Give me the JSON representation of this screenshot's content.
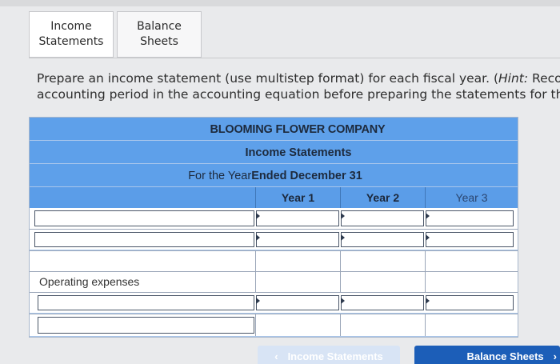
{
  "tabs": [
    {
      "label": "Income\nStatements",
      "active": true
    },
    {
      "label": "Balance\nSheets",
      "active": false
    }
  ],
  "instructions": {
    "line1_a": "Prepare an income statement (use multistep format) for each fiscal year. (",
    "line1_hint": "Hint:",
    "line1_b": " Reco",
    "line2": "accounting period in the accounting equation before preparing the statements for tha"
  },
  "statement": {
    "company": "BLOOMING FLOWER COMPANY",
    "title": "Income Statements",
    "period_a": "For the Year",
    "period_b": " Ended December 31",
    "columns": [
      "Year 1",
      "Year 2",
      "Year 3"
    ],
    "section_operating": "Operating expenses"
  },
  "nav": {
    "prev_label": "Income Statements",
    "prev_icon": "chevron-left-icon",
    "next_label": "Balance Sheets",
    "next_icon": "chevron-right-icon"
  },
  "colors": {
    "header_blue": "#5ea0ea",
    "panel_blue": "#aac6ea",
    "next_button": "#1c5eb8"
  }
}
